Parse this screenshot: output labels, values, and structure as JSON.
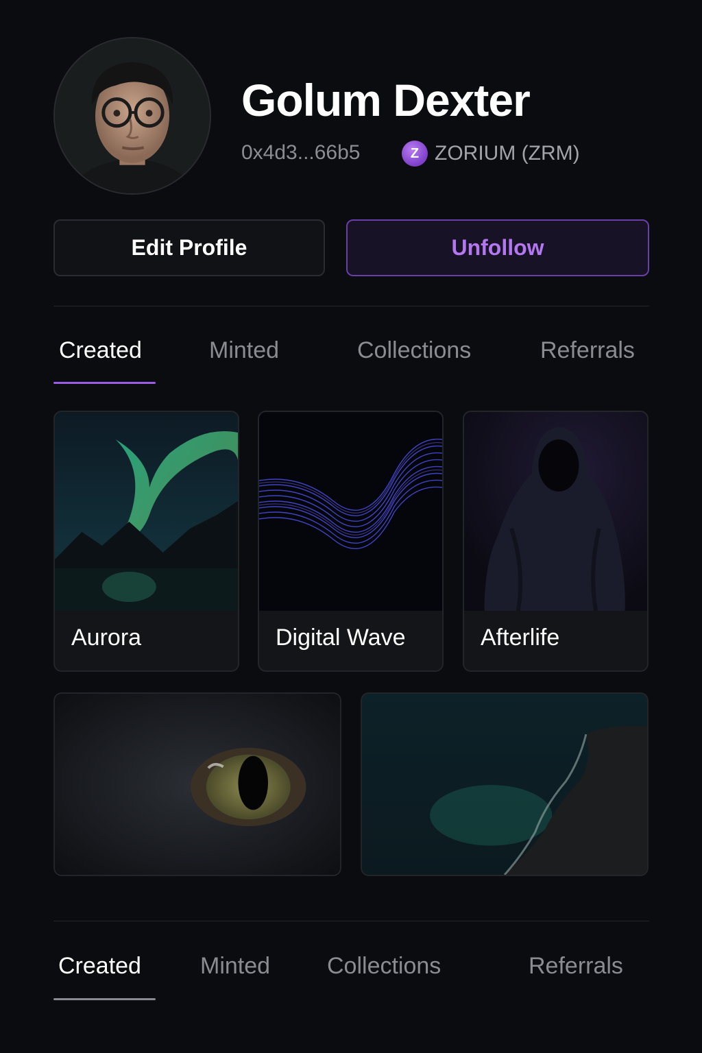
{
  "profile": {
    "name": "Golum Dexter",
    "address": "0x4d3...66b5",
    "token_symbol_letter": "Z",
    "token_label": "ZORIUM (ZRM)",
    "avatar_icon": "user-portrait"
  },
  "actions": {
    "edit_label": "Edit Profile",
    "unfollow_label": "Unfollow"
  },
  "tabs_top": {
    "items": [
      "Created",
      "Minted",
      "Collections",
      "Referrals"
    ],
    "active": "Created",
    "accent": "#9b5de5"
  },
  "cards": [
    {
      "title": "Aurora",
      "art": "aurora-image"
    },
    {
      "title": "Digital Wave",
      "art": "digital-wave-image"
    },
    {
      "title": "Afterlife",
      "art": "hooded-figure-image"
    },
    {
      "title": "",
      "art": "cat-eye-image"
    },
    {
      "title": "",
      "art": "coastline-image"
    }
  ],
  "tabs_bottom": {
    "items": [
      "Created",
      "Minted",
      "Collections",
      "Referrals"
    ],
    "active": "Created",
    "accent": "#8a8b90"
  },
  "colors": {
    "background": "#0b0c0f",
    "accent_purple": "#b378f0"
  }
}
